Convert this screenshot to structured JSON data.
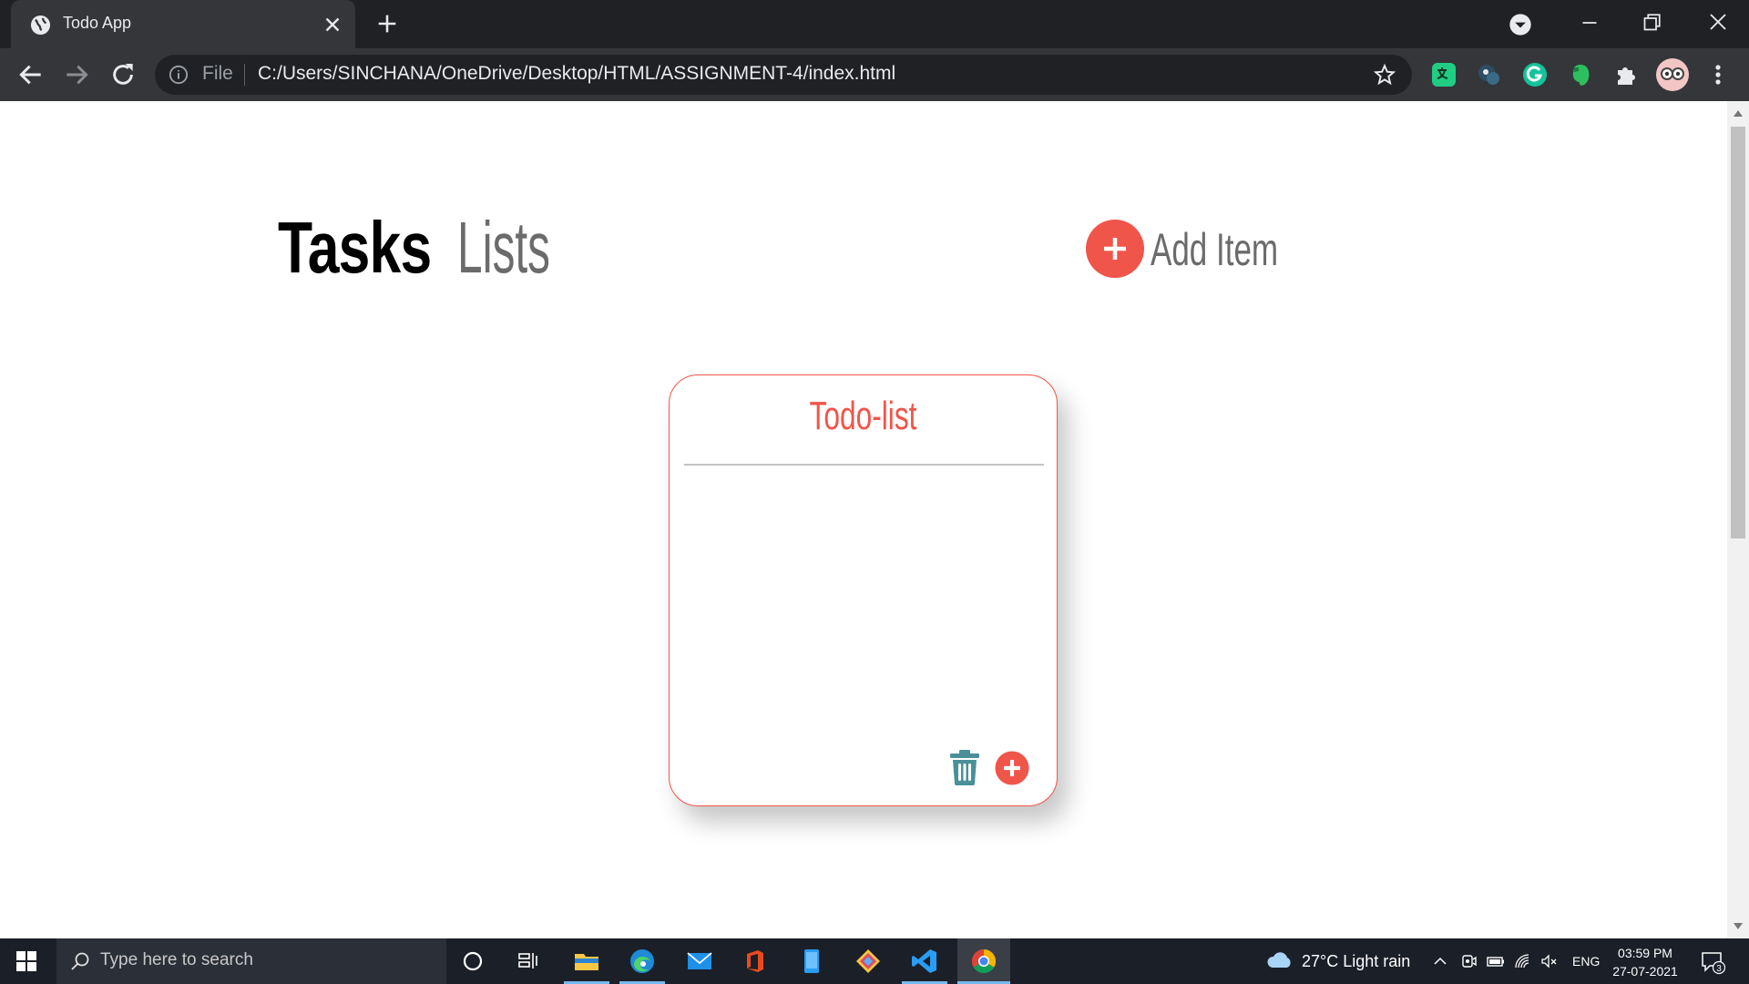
{
  "browser": {
    "tab_title": "Todo App",
    "omnibox_scheme": "File",
    "omnibox_url": "C:/Users/SINCHANA/OneDrive/Desktop/HTML/ASSIGNMENT-4/index.html"
  },
  "page": {
    "nav": {
      "tasks": "Tasks",
      "lists": "Lists"
    },
    "add_item_label": "Add Item",
    "card": {
      "title": "Todo-list"
    },
    "colors": {
      "accent": "#f0554a",
      "trash": "#4a9099"
    }
  },
  "taskbar": {
    "search_placeholder": "Type here to search",
    "weather": "27°C  Light rain",
    "lang": "ENG",
    "time": "03:59 PM",
    "date": "27-07-2021",
    "notification_count": "3"
  }
}
